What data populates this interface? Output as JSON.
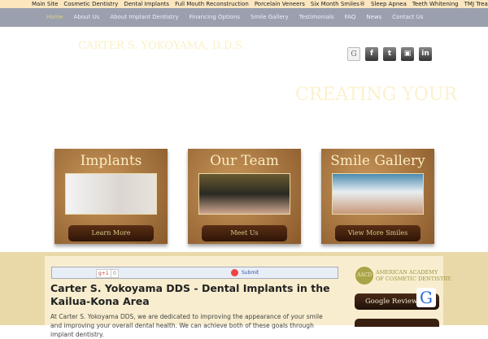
{
  "topbar": [
    "Main Site",
    "Cosmetic Dentistry",
    "Dental Implants",
    "Full Mouth Reconstruction",
    "Porcelain Veneers",
    "Six Month Smiles®",
    "Sleep Apnea",
    "Teeth Whitening",
    "TMJ Treatment"
  ],
  "nav": [
    "Home",
    "About Us",
    "About Implant Dentistry",
    "Financing Options",
    "Smile Gallery",
    "Testimonials",
    "FAQ",
    "News",
    "Contact Us"
  ],
  "logo": "CARTER S. YOKOYAMA, D.D.S.",
  "social": [
    {
      "icon": "google-icon",
      "glyph": "G"
    },
    {
      "icon": "facebook-icon",
      "glyph": "f"
    },
    {
      "icon": "twitter-icon",
      "glyph": "t"
    },
    {
      "icon": "youtube-icon",
      "glyph": "▣"
    },
    {
      "icon": "linkedin-icon",
      "glyph": "in"
    }
  ],
  "hero": "CREATING YOUR",
  "cards": [
    {
      "title": "Implants",
      "button": "Learn More"
    },
    {
      "title": "Our Team",
      "button": "Meet Us"
    },
    {
      "title": "Smile Gallery",
      "button": "View More Smiles"
    }
  ],
  "share": {
    "gplus": "g+1",
    "count": "0",
    "submit": "Submit"
  },
  "content": {
    "title": "Carter S. Yokoyama DDS - Dental Implants in the Kailua-Kona Area",
    "body": "At Carter S. Yokoyama DDS, we are dedicated to improving the appearance of your smile and improving your overall dental health. We can achieve both of these goals through implant dentistry."
  },
  "sidebar": {
    "aacd_seal": "AACD",
    "aacd_line1": "AMERICAN ACADEMY",
    "aacd_line2": "OF COSMETIC DENTISTRY.",
    "google_review": "Google Review",
    "g_badge": "G"
  }
}
